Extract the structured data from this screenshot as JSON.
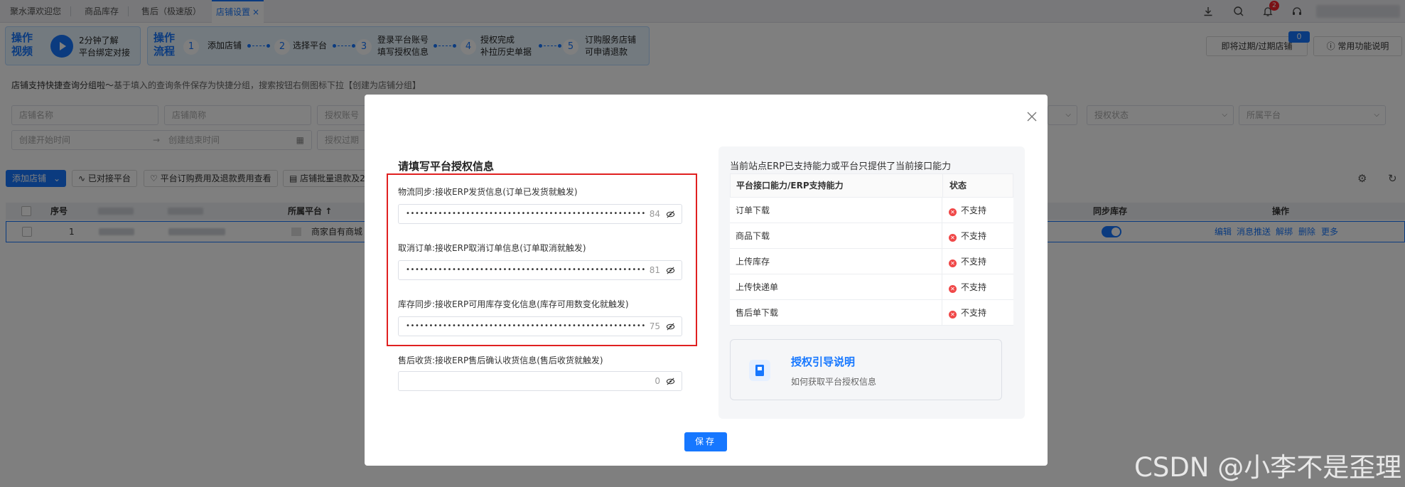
{
  "tabs": [
    {
      "label": "聚水潭欢迎您"
    },
    {
      "label": "商品库存"
    },
    {
      "label": "售后（极速版）"
    },
    {
      "label": "店铺设置",
      "close": "×"
    }
  ],
  "header": {
    "notification_count": "2"
  },
  "guide": {
    "video_tag": "操作\n视频",
    "video_text": "2分钟了解\n平台绑定对接",
    "flow_tag": "操作\n流程",
    "steps": [
      {
        "num": "1",
        "text": "添加店铺"
      },
      {
        "num": "2",
        "text": "选择平台"
      },
      {
        "num": "3",
        "text": "登录平台账号\n填写授权信息"
      },
      {
        "num": "4",
        "text": "授权完成\n补拉历史单据"
      },
      {
        "num": "5",
        "text": "订购服务店铺\n可申请退款"
      }
    ]
  },
  "top_buttons": {
    "expiring": "即将过期/过期店铺",
    "expiring_count": "0",
    "help": "常用功能说明"
  },
  "hint": {
    "main": "店铺支持快捷查询分组啦～",
    "sub": "基于填入的查询条件保存为快捷分组，搜索按钮右侧图标下拉【创建为店铺分组】"
  },
  "filters": {
    "shop_name": "店铺名称",
    "shop_short": "店铺简称",
    "auth_account": "授权账号",
    "auth_status": "授权状态",
    "platform": "所属平台",
    "create_start": "创建开始时间",
    "create_end": "创建结束时间",
    "auth_expire": "授权过期"
  },
  "toolbar": {
    "add_shop": "添加店铺",
    "connected": "已对接平台",
    "fees": "平台订购费用及退款费用查看",
    "batch": "店铺批量退款及2"
  },
  "table": {
    "headers": {
      "seq": "序号",
      "platform": "所属平台",
      "sync": "同步库存",
      "ops": "操作"
    },
    "row": {
      "seq": "1",
      "platform": "商家自有商城"
    },
    "ops": [
      "编辑",
      "消息推送",
      "解绑",
      "删除",
      "更多"
    ]
  },
  "modal": {
    "title": "请填写平台授权信息",
    "fields": [
      {
        "label": "物流同步:接收ERP发货信息(订单已发货就触发)",
        "count": "84",
        "dots": 55
      },
      {
        "label": "取消订单:接收ERP取消订单信息(订单取消就触发)",
        "count": "81",
        "dots": 55
      },
      {
        "label": "库存同步:接收ERP可用库存变化信息(库存可用数变化就触发)",
        "count": "75",
        "dots": 55
      },
      {
        "label": "售后收货:接收ERP售后确认收货信息(售后收货就触发)",
        "count": "0",
        "dots": 0
      }
    ],
    "panel_title": "当前站点ERP已支持能力或平台只提供了当前接口能力",
    "cap_headers": {
      "cap": "平台接口能力/ERP支持能力",
      "status": "状态"
    },
    "capabilities": [
      {
        "name": "订单下载",
        "status": "不支持"
      },
      {
        "name": "商品下载",
        "status": "不支持"
      },
      {
        "name": "上传库存",
        "status": "不支持"
      },
      {
        "name": "上传快递单",
        "status": "不支持"
      },
      {
        "name": "售后单下载",
        "status": "不支持"
      }
    ],
    "guide_title": "授权引导说明",
    "guide_sub": "如何获取平台授权信息",
    "save": "保存"
  },
  "watermark": "CSDN @小李不是歪理",
  "colors": {
    "accent": "#1677ff",
    "error": "#f04848",
    "highlight_frame": "#e02020"
  }
}
